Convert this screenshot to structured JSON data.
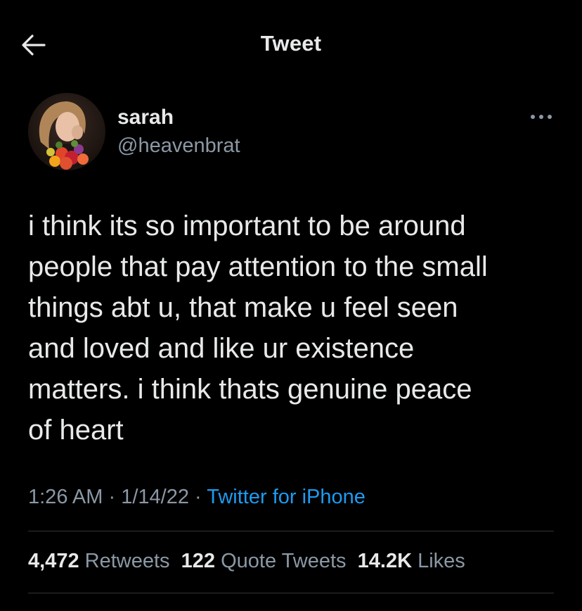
{
  "header": {
    "title": "Tweet"
  },
  "author": {
    "display_name": "sarah",
    "handle": "@heavenbrat"
  },
  "tweet": {
    "text": "i think its so important to be around\npeople that pay attention to the small\nthings abt u, that make u feel seen\nand loved and like ur existence\nmatters. i think thats genuine peace\nof heart"
  },
  "meta": {
    "time": "1:26 AM",
    "separator": "·",
    "date": "1/14/22",
    "source": "Twitter for iPhone"
  },
  "stats": {
    "retweets_count": "4,472",
    "retweets_label": "Retweets",
    "quotes_count": "122",
    "quotes_label": "Quote Tweets",
    "likes_count": "14.2K",
    "likes_label": "Likes"
  },
  "colors": {
    "background": "#000000",
    "text": "#e7e9ea",
    "secondary": "#8b98a5",
    "link": "#1d9bf0",
    "divider": "#2f3336"
  },
  "icons": {
    "back": "arrow-left-icon",
    "more": "ellipsis-icon"
  }
}
